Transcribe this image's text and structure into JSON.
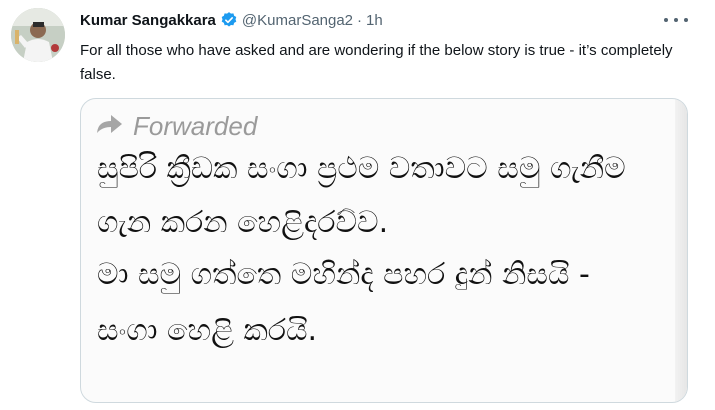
{
  "tweet": {
    "author_name": "Kumar Sangakkara",
    "handle": "@KumarSanga2",
    "separator": "·",
    "time": "1h",
    "text": "For all those who have asked and are wondering if the below story is true - it’s completely false.",
    "icons": {
      "verified": "verified-badge-icon",
      "more": "more-options-icon",
      "forward": "forward-arrow-icon"
    },
    "colors": {
      "verified": "#1d9bf0",
      "secondary_text": "#536471",
      "primary_text": "#0f1419"
    }
  },
  "media": {
    "forwarded_label": "Forwarded",
    "lines": [
      "සුපිරි ක්‍රීඩක සංගා ප්‍රථම වතාවට සමු ගැනීම",
      "ගැන කරන හෙළිදරව්ව.",
      "මා සමු ගත්තෙ මහින්ද පහර දුන් නිසයි -",
      "සංගා හෙළි කරයි."
    ]
  }
}
